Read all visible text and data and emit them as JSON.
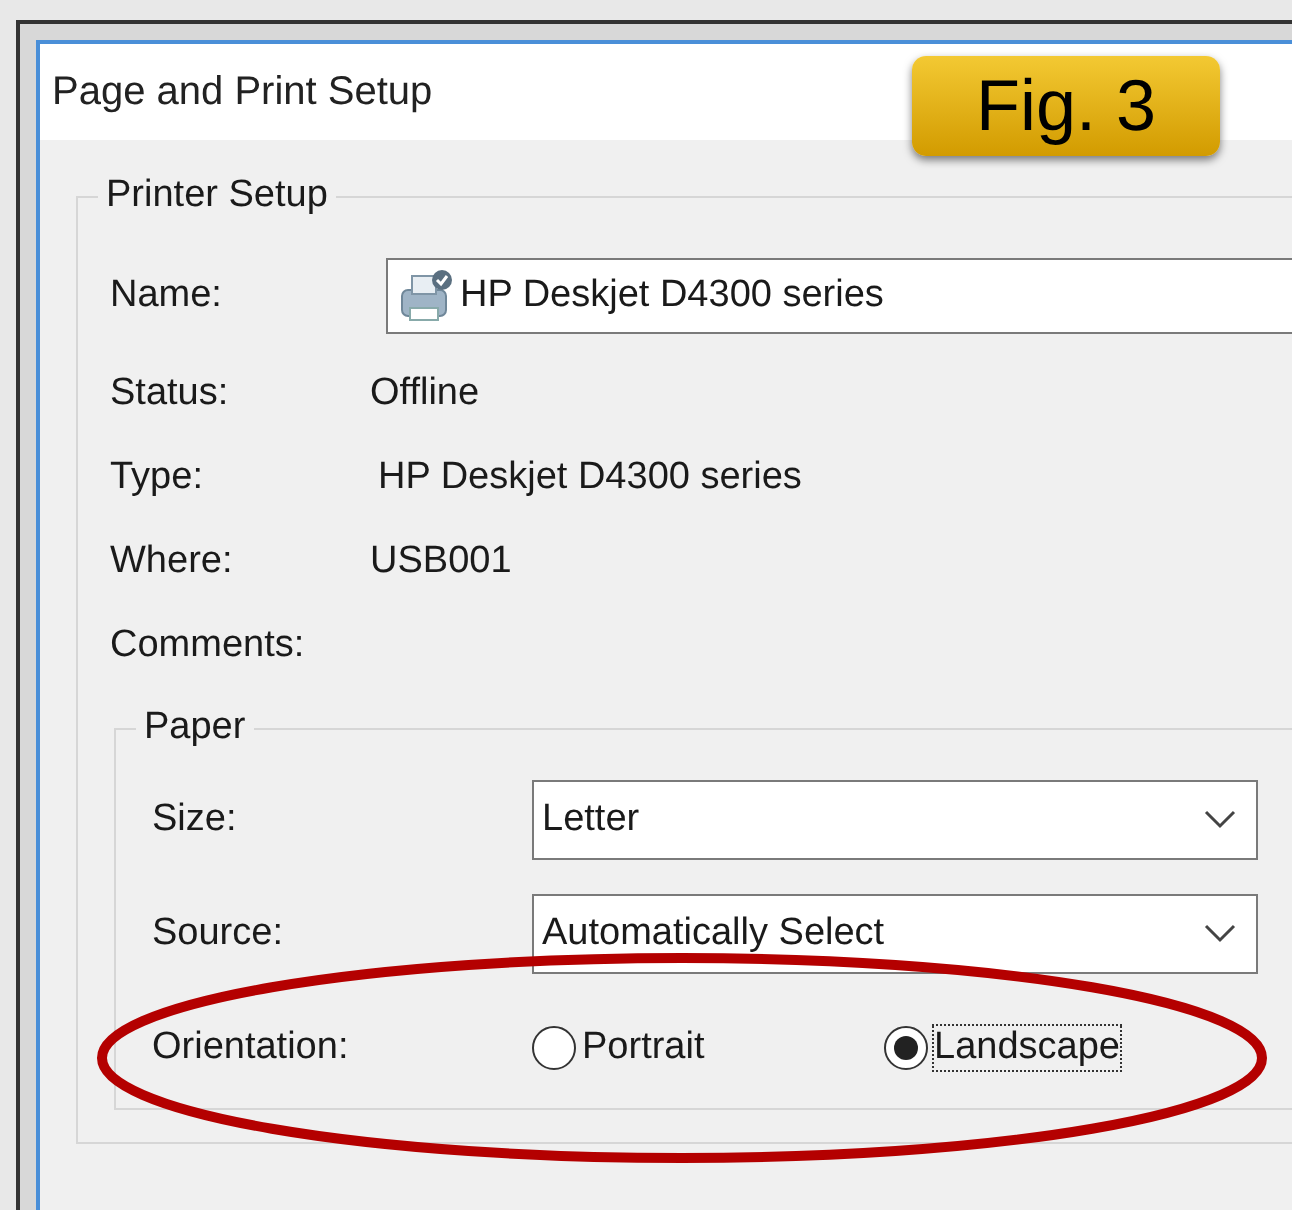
{
  "window": {
    "title": "Page and Print Setup"
  },
  "badge": {
    "text": "Fig. 3"
  },
  "printer_setup": {
    "legend": "Printer Setup",
    "name": {
      "label": "Name:",
      "value": "HP Deskjet D4300 series"
    },
    "rows": [
      {
        "label": "Status:",
        "value": "Offline"
      },
      {
        "label": "Type:",
        "value": "HP Deskjet D4300 series"
      },
      {
        "label": "Where:",
        "value": "USB001"
      },
      {
        "label": "Comments:"
      }
    ]
  },
  "paper": {
    "legend": "Paper",
    "dropdowns": [
      {
        "label": "Size:",
        "value": "Letter"
      },
      {
        "label": "Source:",
        "value": "Automatically Select"
      }
    ],
    "orientation": {
      "label": "Orientation:",
      "options": [
        {
          "label": "Portrait",
          "selected": false
        },
        {
          "label": "Landscape",
          "selected": true
        }
      ]
    }
  },
  "highlight": {
    "visible": true
  }
}
